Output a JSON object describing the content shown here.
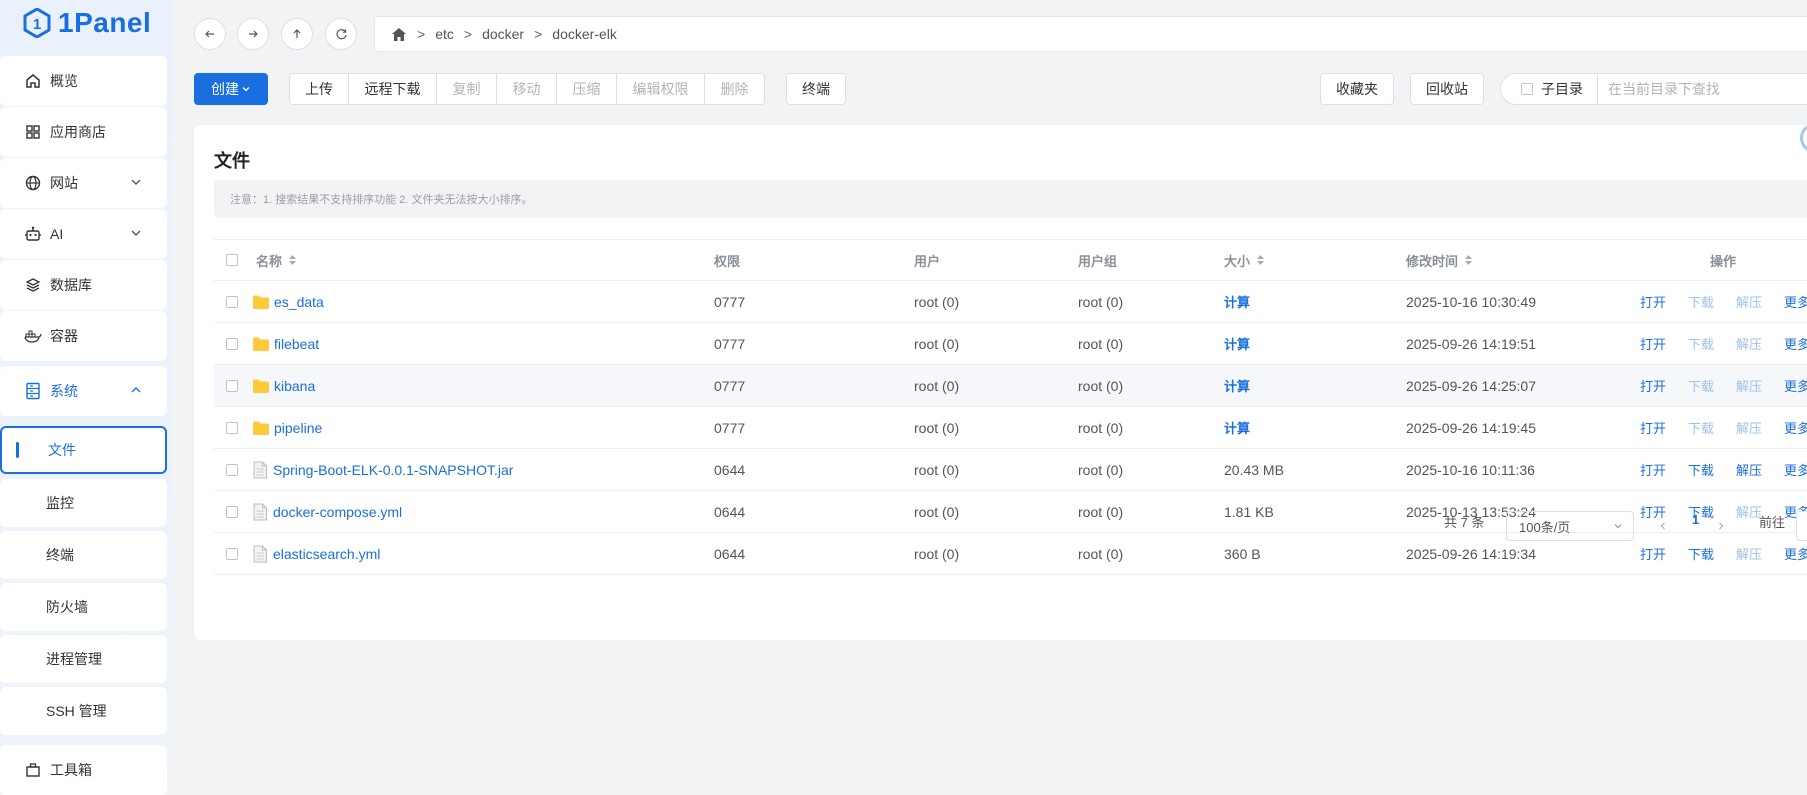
{
  "app": {
    "name": "1Panel"
  },
  "sidebar": {
    "items": [
      {
        "label": "概览",
        "icon": "home-icon"
      },
      {
        "label": "应用商店",
        "icon": "app-store-icon"
      },
      {
        "label": "网站",
        "icon": "globe-icon"
      },
      {
        "label": "AI",
        "icon": "robot-icon"
      },
      {
        "label": "数据库",
        "icon": "database-icon"
      },
      {
        "label": "容器",
        "icon": "docker-icon"
      },
      {
        "label": "系统",
        "icon": "server-icon"
      }
    ],
    "system_sub": [
      {
        "label": "文件",
        "selected": true
      },
      {
        "label": "监控"
      },
      {
        "label": "终端"
      },
      {
        "label": "防火墙"
      },
      {
        "label": "进程管理"
      },
      {
        "label": "SSH 管理"
      }
    ],
    "toolbox_label": "工具箱"
  },
  "breadcrumb": {
    "sep": ">",
    "parts": [
      "etc",
      "docker",
      "docker-elk"
    ]
  },
  "toolbar": {
    "create": "创建",
    "upload": "上传",
    "remote_download": "远程下载",
    "copy": "复制",
    "move": "移动",
    "compress": "压缩",
    "edit_perm": "编辑权限",
    "delete": "删除",
    "terminal": "终端",
    "favorites": "收藏夹",
    "recycle_bin": "回收站",
    "subdir": "子目录",
    "search_placeholder": "在当前目录下查找"
  },
  "main": {
    "title": "文件",
    "notice": "注意：1. 搜索结果不支持排序功能 2. 文件夹无法按大小排序。"
  },
  "table": {
    "columns": {
      "name": "名称",
      "perm": "权限",
      "user": "用户",
      "group": "用户组",
      "size": "大小",
      "mtime": "修改时间",
      "ops": "操作"
    },
    "op_labels": {
      "open": "打开",
      "download": "下载",
      "extract": "解压",
      "more": "更多"
    },
    "rows": [
      {
        "name": "es_data",
        "type": "folder",
        "perm": "0777",
        "user": "root (0)",
        "group": "root (0)",
        "size": "计算",
        "mtime": "2025-10-16 10:30:49",
        "download_enabled": false,
        "extract_enabled": false
      },
      {
        "name": "filebeat",
        "type": "folder",
        "perm": "0777",
        "user": "root (0)",
        "group": "root (0)",
        "size": "计算",
        "mtime": "2025-09-26 14:19:51",
        "download_enabled": false,
        "extract_enabled": false
      },
      {
        "name": "kibana",
        "type": "folder",
        "perm": "0777",
        "user": "root (0)",
        "group": "root (0)",
        "size": "计算",
        "mtime": "2025-09-26 14:25:07",
        "download_enabled": false,
        "extract_enabled": false
      },
      {
        "name": "pipeline",
        "type": "folder",
        "perm": "0777",
        "user": "root (0)",
        "group": "root (0)",
        "size": "计算",
        "mtime": "2025-09-26 14:19:45",
        "download_enabled": false,
        "extract_enabled": false
      },
      {
        "name": "Spring-Boot-ELK-0.0.1-SNAPSHOT.jar",
        "type": "file",
        "perm": "0644",
        "user": "root (0)",
        "group": "root (0)",
        "size": "20.43 MB",
        "mtime": "2025-10-16 10:11:36",
        "download_enabled": true,
        "extract_enabled": true
      },
      {
        "name": "docker-compose.yml",
        "type": "file",
        "perm": "0644",
        "user": "root (0)",
        "group": "root (0)",
        "size": "1.81 KB",
        "mtime": "2025-10-13 13:53:24",
        "download_enabled": true,
        "extract_enabled": false
      },
      {
        "name": "elasticsearch.yml",
        "type": "file",
        "perm": "0644",
        "user": "root (0)",
        "group": "root (0)",
        "size": "360 B",
        "mtime": "2025-09-26 14:19:34",
        "download_enabled": true,
        "extract_enabled": false
      }
    ]
  },
  "pagination": {
    "total": "共 7 条",
    "page_size": "100条/页",
    "current_page": "1",
    "goto": "前往"
  },
  "colors": {
    "accent": "#1a6fe0",
    "folder": "#ffc93c"
  }
}
